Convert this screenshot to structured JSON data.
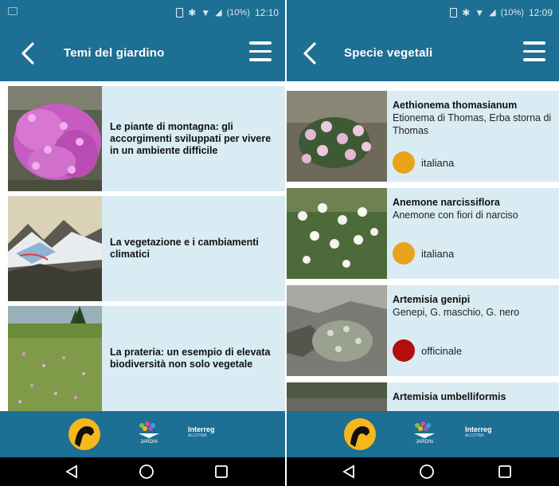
{
  "left_screen": {
    "status_bar": {
      "time": "12:10",
      "battery_label": "(10%)"
    },
    "title": "Temi del giardino",
    "themes": [
      {
        "text": "Le piante di montagna: gli accorgimenti sviluppati per vivere in un ambiente difficile"
      },
      {
        "text": "La vegetazione e i cambiamenti climatici"
      },
      {
        "text": "La prateria: un esempio di elevata biodiversità non solo vegetale"
      }
    ]
  },
  "right_screen": {
    "status_bar": {
      "time": "12:09",
      "battery_label": "(10%)"
    },
    "title": "Specie vegetali",
    "species": [
      {
        "name": "Aethionema thomasianum",
        "common": "Etionema di Thomas, Erba storna di Thomas",
        "status": "italiana",
        "status_color": "#e8a21c"
      },
      {
        "name": "Anemone narcissiflora",
        "common": "Anemone con fiori di narciso",
        "status": "italiana",
        "status_color": "#e8a21c"
      },
      {
        "name": "Artemisia genipi",
        "common": "Genepi, G. maschio, G. nero",
        "status": "officinale",
        "status_color": "#b20e0e"
      },
      {
        "name": "Artemisia umbelliformis",
        "common": "",
        "status": "",
        "status_color": ""
      }
    ]
  },
  "footer": {
    "jardin_label": "JARDIN",
    "interreg_label": "Interreg",
    "interreg_sub": "ALCOTRA"
  },
  "colors": {
    "primary": "#1d6f93",
    "row_background": "#d9ecf4",
    "logo_yellow": "#f4b81c"
  }
}
